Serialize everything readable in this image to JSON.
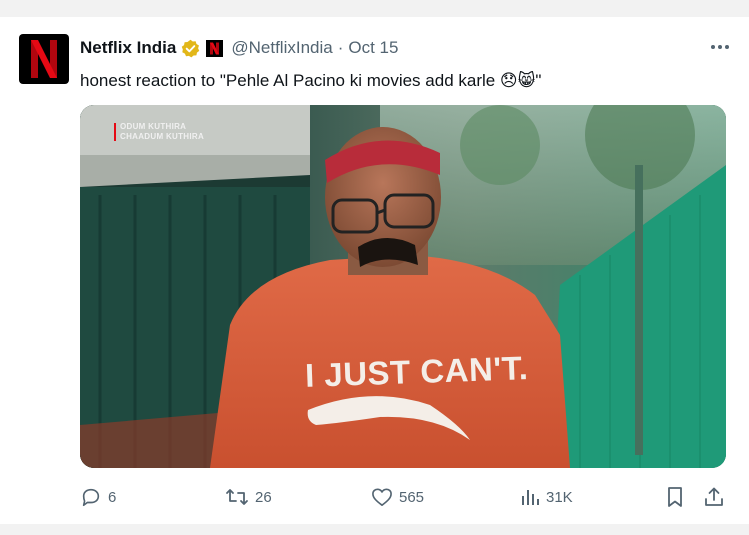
{
  "tweet": {
    "author_name": "Netflix India",
    "avatar_letter": "N",
    "handle": "@NetflixIndia",
    "separator": "·",
    "date": "Oct 15",
    "text": "honest reaction to \"Pehle Al Pacino ki movies add karle 😞😸\"",
    "media": {
      "caption_line1": "ODUM KUTHIRA",
      "caption_line2": "CHAADUM KUTHIRA",
      "shirt_text": "I JUST CAN'T."
    },
    "actions": {
      "replies": "6",
      "retweets": "26",
      "likes": "565",
      "views": "31K"
    }
  },
  "colors": {
    "brand_red": "#e50914",
    "verified_gold": "#e2b719",
    "text_secondary": "#536471"
  }
}
